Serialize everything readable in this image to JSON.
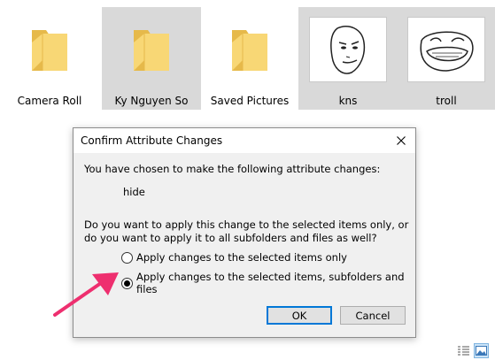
{
  "files": [
    {
      "name": "Camera Roll",
      "kind": "folder",
      "selected": false
    },
    {
      "name": "Ky Nguyen So",
      "kind": "folder",
      "selected": true
    },
    {
      "name": "Saved Pictures",
      "kind": "folder",
      "selected": false
    },
    {
      "name": "kns",
      "kind": "image",
      "icon": "meme-face-thumbnail",
      "selected": true
    },
    {
      "name": "troll",
      "kind": "image",
      "icon": "troll-face-thumbnail",
      "selected": true
    }
  ],
  "dialog": {
    "title": "Confirm Attribute Changes",
    "message": "You have chosen to make the following attribute changes:",
    "attribute": "hide",
    "question": "Do you want to apply this change to the selected items only, or do you want to apply it to all subfolders and files as well?",
    "options": [
      {
        "label": "Apply changes to the selected items only",
        "checked": false
      },
      {
        "label": "Apply changes to the selected items, subfolders and files",
        "checked": true
      }
    ],
    "ok_label": "OK",
    "cancel_label": "Cancel"
  },
  "colors": {
    "selection": "#d9d9d9",
    "folder": "#f8d775",
    "folder_dark": "#e6b94a",
    "arrow": "#ee2f6f",
    "accent": "#0078d7"
  },
  "view_icons": [
    "details-view-icon",
    "large-icons-view-icon"
  ]
}
